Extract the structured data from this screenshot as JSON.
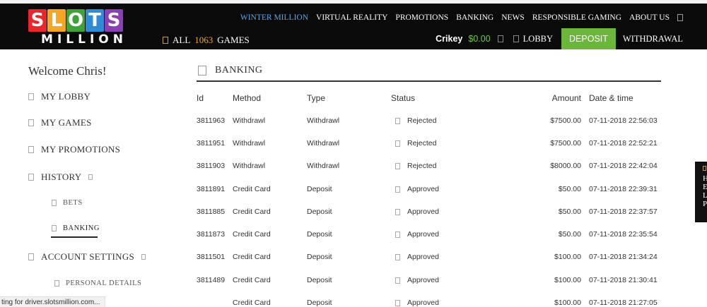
{
  "header": {
    "logo": {
      "letters": [
        "S",
        "L",
        "O",
        "T",
        "S"
      ],
      "letter_colors": [
        "#e8262b",
        "#f5a623",
        "#3fa33a",
        "#2e8bd6",
        "#8a3fb5"
      ],
      "subtitle": "MILLION"
    },
    "all_games": {
      "prefix": "ALL",
      "count": "1063",
      "suffix": "GAMES"
    },
    "nav": [
      {
        "label": "WINTER MILLION",
        "active": true
      },
      {
        "label": "VIRTUAL REALITY"
      },
      {
        "label": "PROMOTIONS"
      },
      {
        "label": "BANKING"
      },
      {
        "label": "NEWS"
      },
      {
        "label": "RESPONSIBLE GAMING"
      },
      {
        "label": "ABOUT US"
      }
    ],
    "user": {
      "name": "Crikey",
      "balance": "$0.00"
    },
    "lobby_label": "LOBBY",
    "deposit_label": "DEPOSIT",
    "withdrawal_label": "WITHDRAWAL"
  },
  "sidebar": {
    "welcome": "Welcome Chris!",
    "items": [
      {
        "label": "MY LOBBY"
      },
      {
        "label": "MY GAMES"
      },
      {
        "label": "MY PROMOTIONS"
      },
      {
        "label": "HISTORY"
      },
      {
        "label": "ACCOUNT SETTINGS"
      }
    ],
    "history_sub": [
      {
        "label": "BETS"
      },
      {
        "label": "BANKING",
        "active": true
      }
    ],
    "account_sub": [
      {
        "label": "PERSONAL DETAILS"
      }
    ]
  },
  "banking": {
    "title": "BANKING",
    "columns": {
      "id": "Id",
      "method": "Method",
      "type": "Type",
      "status": "Status",
      "amount": "Amount",
      "date": "Date & time"
    },
    "rows": [
      {
        "id": "3811963",
        "method": "Withdrawl",
        "type": "Withdrawl",
        "status": "Rejected",
        "amount": "$7500.00",
        "date": "07-11-2018 22:56:03"
      },
      {
        "id": "3811951",
        "method": "Withdrawl",
        "type": "Withdrawl",
        "status": "Rejected",
        "amount": "$7500.00",
        "date": "07-11-2018 22:52:21"
      },
      {
        "id": "3811903",
        "method": "Withdrawl",
        "type": "Withdrawl",
        "status": "Rejected",
        "amount": "$8000.00",
        "date": "07-11-2018 22:42:04"
      },
      {
        "id": "3811891",
        "method": "Credit Card",
        "type": "Deposit",
        "status": "Approved",
        "amount": "$50.00",
        "date": "07-11-2018 22:39:31"
      },
      {
        "id": "3811885",
        "method": "Credit Card",
        "type": "Deposit",
        "status": "Approved",
        "amount": "$50.00",
        "date": "07-11-2018 22:37:57"
      },
      {
        "id": "3811873",
        "method": "Credit Card",
        "type": "Deposit",
        "status": "Approved",
        "amount": "$50.00",
        "date": "07-11-2018 22:35:54"
      },
      {
        "id": "3811501",
        "method": "Credit Card",
        "type": "Deposit",
        "status": "Approved",
        "amount": "$100.00",
        "date": "07-11-2018 21:34:24"
      },
      {
        "id": "3811489",
        "method": "Credit Card",
        "type": "Deposit",
        "status": "Approved",
        "amount": "$100.00",
        "date": "07-11-2018 21:30:41"
      },
      {
        "id": "",
        "method": "Credit Card",
        "type": "Deposit",
        "status": "Approved",
        "amount": "$100.00",
        "date": "07-11-2018 21:27:05"
      }
    ]
  },
  "edge_widget": {
    "letters": [
      "H",
      "E",
      "L",
      "P"
    ]
  },
  "statusbar": {
    "text": "ting for driver.slotsmillion.com..."
  },
  "colors": {
    "deposit_green": "#6ab73a",
    "balance_green": "#6fcf3a",
    "active_nav_blue": "#5aa8e6",
    "header_bg": "#0a0a0a",
    "games_count_orange": "#f0a830"
  }
}
